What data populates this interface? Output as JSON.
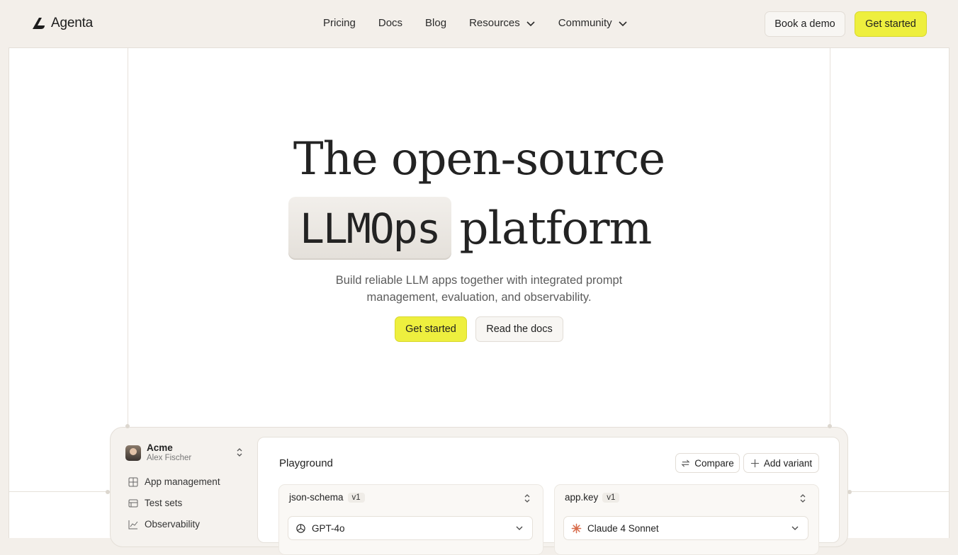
{
  "brand": {
    "name": "Agenta"
  },
  "nav": {
    "links": [
      {
        "label": "Pricing",
        "dropdown": false
      },
      {
        "label": "Docs",
        "dropdown": false
      },
      {
        "label": "Blog",
        "dropdown": false
      },
      {
        "label": "Resources",
        "dropdown": true
      },
      {
        "label": "Community",
        "dropdown": true
      }
    ],
    "book_demo": "Book a demo",
    "get_started": "Get started"
  },
  "hero": {
    "line1": "The open-source",
    "highlight": "LLMOps",
    "line2_rest": "platform",
    "subtitle_line1": "Build reliable LLM apps together with integrated prompt",
    "subtitle_line2": "management, evaluation, and observability.",
    "primary_cta": "Get started",
    "secondary_cta": "Read the docs"
  },
  "app": {
    "org_name": "Acme",
    "user_name": "Alex Fischer",
    "sidebar": [
      {
        "label": "App management",
        "icon": "grid-icon"
      },
      {
        "label": "Test sets",
        "icon": "table-icon"
      },
      {
        "label": "Observability",
        "icon": "chart-icon"
      }
    ],
    "page_title": "Playground",
    "compare_label": "Compare",
    "add_variant_label": "Add variant",
    "variants": [
      {
        "name": "json-schema",
        "version": "v1",
        "model": "GPT-4o",
        "model_icon": "openai-icon"
      },
      {
        "name": "app.key",
        "version": "v1",
        "model": "Claude 4 Sonnet",
        "model_icon": "anthropic-icon"
      }
    ]
  },
  "colors": {
    "accent_yellow": "#eeef3e",
    "page_bg": "#f3efea",
    "text_primary": "#232323"
  }
}
